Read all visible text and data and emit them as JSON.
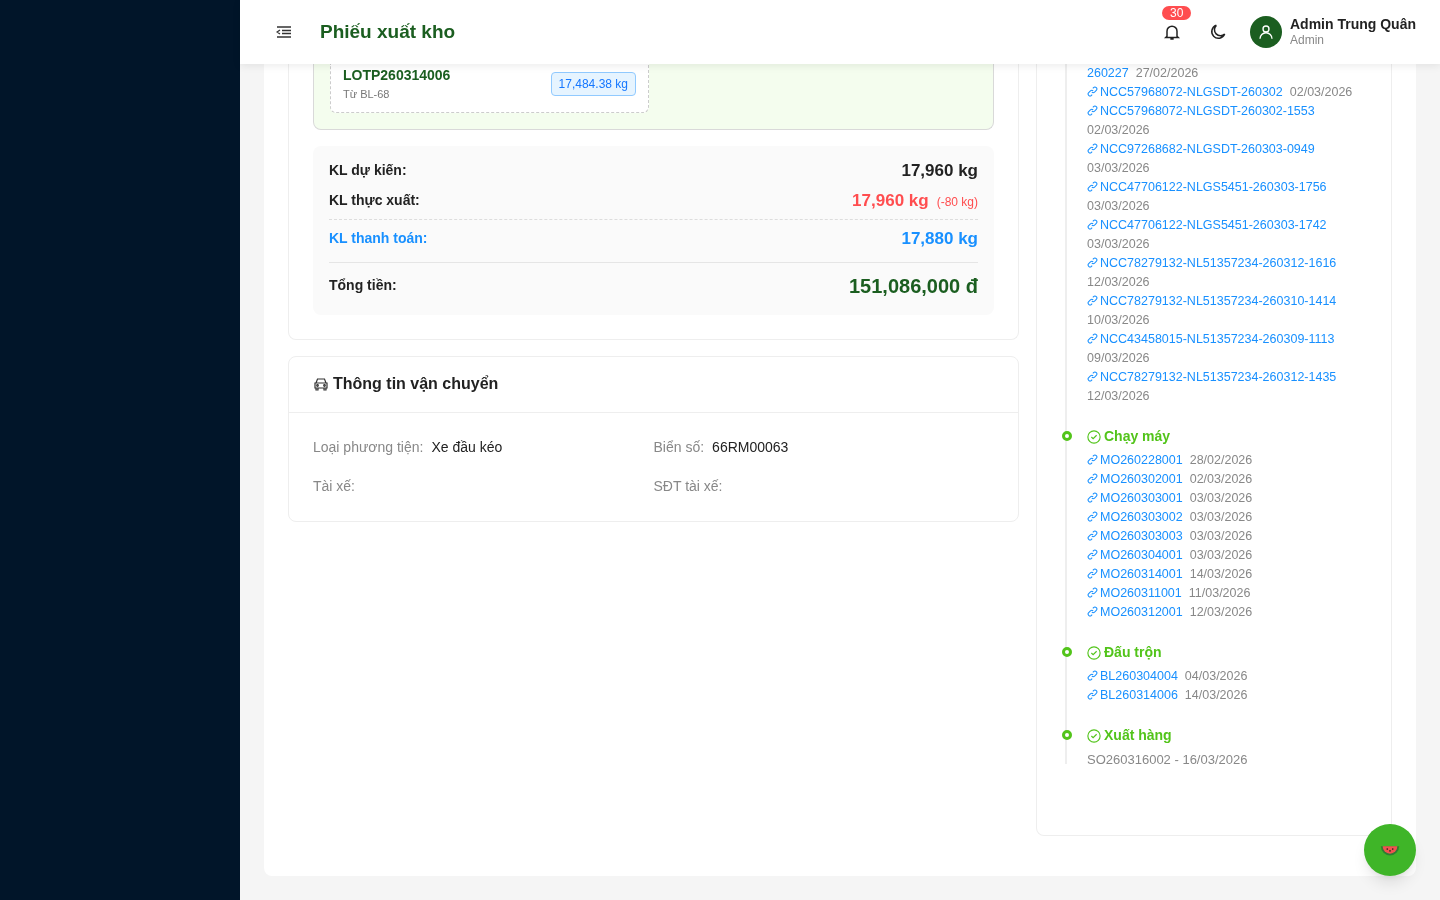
{
  "header": {
    "title": "Phiếu xuất kho",
    "notification_count": "30",
    "user": {
      "name": "Admin Trung Quân",
      "role": "Admin"
    }
  },
  "lot": {
    "code": "LOTP260314006",
    "source": "Từ BL-68",
    "weight": "17,484.38 kg"
  },
  "summary": [
    {
      "kind": "plain",
      "label": "KL dự kiến:",
      "value": "17,960 kg"
    },
    {
      "kind": "actual",
      "label": "KL thực xuất:",
      "value": "17,960 kg",
      "diff": "(-80 kg)"
    },
    {
      "kind": "payment",
      "label": "KL thanh toán:",
      "value": "17,880 kg"
    },
    {
      "kind": "total",
      "label": "Tổng tiền:",
      "value": "151,086,000 đ"
    }
  ],
  "transport": {
    "title": "Thông tin vận chuyển",
    "fields": [
      {
        "label": "Loại phương tiện:",
        "value": "Xe đầu kéo"
      },
      {
        "label": "Biển số:",
        "value": "66RM00063"
      },
      {
        "label": "Tài xế:"
      },
      {
        "label": "SĐT tài xế:"
      }
    ]
  },
  "timeline": [
    {
      "links": [
        {
          "code": "260227",
          "date": "27/02/2026",
          "cut": true
        },
        {
          "code": "NCC57968072-NLGSDT-260302",
          "date": "02/03/2026"
        },
        {
          "code": "NCC57968072-NLGSDT-260302-1553",
          "date": "02/03/2026"
        },
        {
          "code": "NCC97268682-NLGSDT-260303-0949",
          "date": "03/03/2026"
        },
        {
          "code": "NCC47706122-NLGS5451-260303-1756",
          "date": "03/03/2026"
        },
        {
          "code": "NCC47706122-NLGS5451-260303-1742",
          "date": "03/03/2026"
        },
        {
          "code": "NCC78279132-NL51357234-260312-1616",
          "date": "12/03/2026"
        },
        {
          "code": "NCC78279132-NL51357234-260310-1414",
          "date": "10/03/2026"
        },
        {
          "code": "NCC43458015-NL51357234-260309-1113",
          "date": "09/03/2026"
        },
        {
          "code": "NCC78279132-NL51357234-260312-1435",
          "date": "12/03/2026"
        }
      ]
    },
    {
      "title": "Chạy máy",
      "links": [
        {
          "code": "MO260228001",
          "date": "28/02/2026"
        },
        {
          "code": "MO260302001",
          "date": "02/03/2026"
        },
        {
          "code": "MO260303001",
          "date": "03/03/2026"
        },
        {
          "code": "MO260303002",
          "date": "03/03/2026"
        },
        {
          "code": "MO260303003",
          "date": "03/03/2026"
        },
        {
          "code": "MO260304001",
          "date": "03/03/2026"
        },
        {
          "code": "MO260314001",
          "date": "14/03/2026"
        },
        {
          "code": "MO260311001",
          "date": "11/03/2026"
        },
        {
          "code": "MO260312001",
          "date": "12/03/2026"
        }
      ]
    },
    {
      "title": "Đấu trộn",
      "links": [
        {
          "code": "BL260304004",
          "date": "04/03/2026"
        },
        {
          "code": "BL260314006",
          "date": "14/03/2026"
        }
      ]
    },
    {
      "title": "Xuất hàng",
      "note": "SO260316002 - 16/03/2026"
    }
  ]
}
